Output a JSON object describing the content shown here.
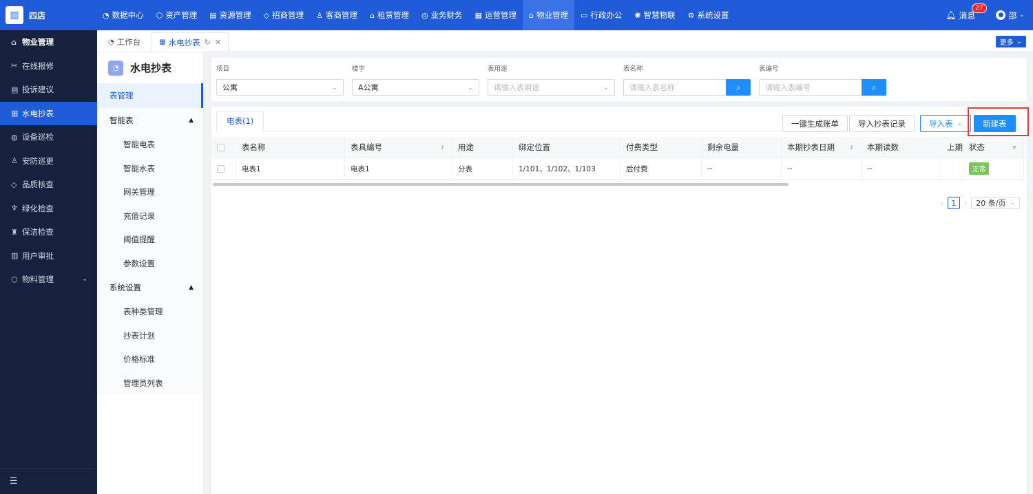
{
  "app": {
    "logo_icon": "building-icon",
    "logo_text": "四店"
  },
  "topnav": [
    {
      "icon": "◔",
      "label": "数据中心",
      "active": false
    },
    {
      "icon": "⬡",
      "label": "资产管理",
      "active": false
    },
    {
      "icon": "▤",
      "label": "资源管理",
      "active": false
    },
    {
      "icon": "◇",
      "label": "招商管理",
      "active": false
    },
    {
      "icon": "♙",
      "label": "客商管理",
      "active": false
    },
    {
      "icon": "⌂",
      "label": "租赁管理",
      "active": false
    },
    {
      "icon": "◎",
      "label": "业务财务",
      "active": false
    },
    {
      "icon": "▦",
      "label": "运营管理",
      "active": false
    },
    {
      "icon": "⌂",
      "label": "物业管理",
      "active": true
    },
    {
      "icon": "▭",
      "label": "行政办公",
      "active": false
    },
    {
      "icon": "✺",
      "label": "智慧物联",
      "active": false
    },
    {
      "icon": "⚙",
      "label": "系统设置",
      "active": false
    }
  ],
  "topright": {
    "messages_label": "消息",
    "message_count": "27",
    "user_label": "邵"
  },
  "sidebar": {
    "header": "物业管理",
    "items": [
      {
        "icon": "✂",
        "label": "在线报修"
      },
      {
        "icon": "▤",
        "label": "投诉建议"
      },
      {
        "icon": "▦",
        "label": "水电抄表"
      },
      {
        "icon": "◍",
        "label": "设备巡检"
      },
      {
        "icon": "♙",
        "label": "安防巡更"
      },
      {
        "icon": "◇",
        "label": "品质核查"
      },
      {
        "icon": "♆",
        "label": "绿化检查"
      },
      {
        "icon": "♜",
        "label": "保洁检查"
      },
      {
        "icon": "▥",
        "label": "用户审批"
      },
      {
        "icon": "⬡",
        "label": "物料管理"
      }
    ],
    "active_index": 2
  },
  "tabs": {
    "workbench": "工作台",
    "current": "水电抄表",
    "more": "更多"
  },
  "subside": {
    "title": "水电抄表",
    "active": "表管理",
    "groups": [
      {
        "label": "智能表",
        "children": [
          "智能电表",
          "智能水表",
          "网关管理",
          "充值记录",
          "阈值提醒",
          "参数设置"
        ]
      },
      {
        "label": "系统设置",
        "children": [
          "表种类管理",
          "抄表计划",
          "价格标准",
          "管理员列表"
        ]
      }
    ]
  },
  "filters": {
    "project_label": "项目",
    "project_value": "公寓",
    "building_label": "楼宇",
    "building_value": "A公寓",
    "usage_label": "表用途",
    "usage_placeholder": "请输入表用途",
    "name_label": "表名称",
    "name_placeholder": "请输入表名称",
    "code_label": "表编号",
    "code_placeholder": "请输入表编号"
  },
  "main": {
    "tab_label": "电表(1)",
    "btn_generate": "一键生成账单",
    "btn_import_record": "导入抄表记录",
    "btn_import": "导入表",
    "btn_new": "新建表"
  },
  "table": {
    "columns": [
      "表名称",
      "表具编号",
      "用途",
      "绑定位置",
      "付费类型",
      "剩余电量",
      "本期抄表日期",
      "本期读数",
      "上期",
      "状态"
    ],
    "rows": [
      {
        "name": "电表1",
        "code": "电表1",
        "usage": "分表",
        "location": "1/101、1/102、1/103",
        "pay_type": "后付费",
        "remaining": "--",
        "date": "--",
        "reading": "--",
        "prev": "",
        "status": "正常"
      }
    ]
  },
  "pagination": {
    "current": "1",
    "page_size": "20 条/页"
  }
}
